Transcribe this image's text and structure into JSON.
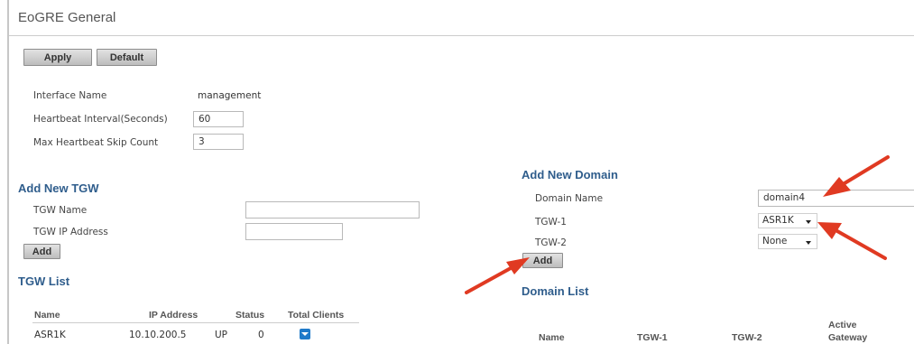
{
  "page": {
    "title": "EoGRE General"
  },
  "toolbar": {
    "apply_label": "Apply",
    "default_label": "Default"
  },
  "general": {
    "interface_name_label": "Interface Name",
    "interface_name_value": "management",
    "heartbeat_interval_label": "Heartbeat Interval(Seconds)",
    "heartbeat_interval_value": "60",
    "max_skip_label": "Max Heartbeat Skip Count",
    "max_skip_value": "3"
  },
  "add_tgw": {
    "title": "Add New TGW",
    "name_label": "TGW Name",
    "name_value": "",
    "ip_label": "TGW IP Address",
    "ip_value": "",
    "add_label": "Add"
  },
  "tgw_list": {
    "title": "TGW List",
    "columns": [
      "Name",
      "IP Address",
      "Status",
      "Total Clients"
    ],
    "rows": [
      {
        "name": "ASR1K",
        "ip": "10.10.200.5",
        "status": "UP",
        "clients": "0"
      }
    ]
  },
  "add_domain": {
    "title": "Add New Domain",
    "name_label": "Domain Name",
    "name_value": "domain4",
    "tgw1_label": "TGW-1",
    "tgw1_value": "ASR1K",
    "tgw2_label": "TGW-2",
    "tgw2_value": "None",
    "add_label": "Add"
  },
  "domain_list": {
    "title": "Domain List",
    "columns": [
      "Name",
      "TGW-1",
      "TGW-2",
      "Active",
      "Gateway"
    ]
  },
  "colors": {
    "section_title": "#2f5d8c",
    "annotation_arrow": "#e03a22",
    "row_icon": "#1f7ac9"
  }
}
